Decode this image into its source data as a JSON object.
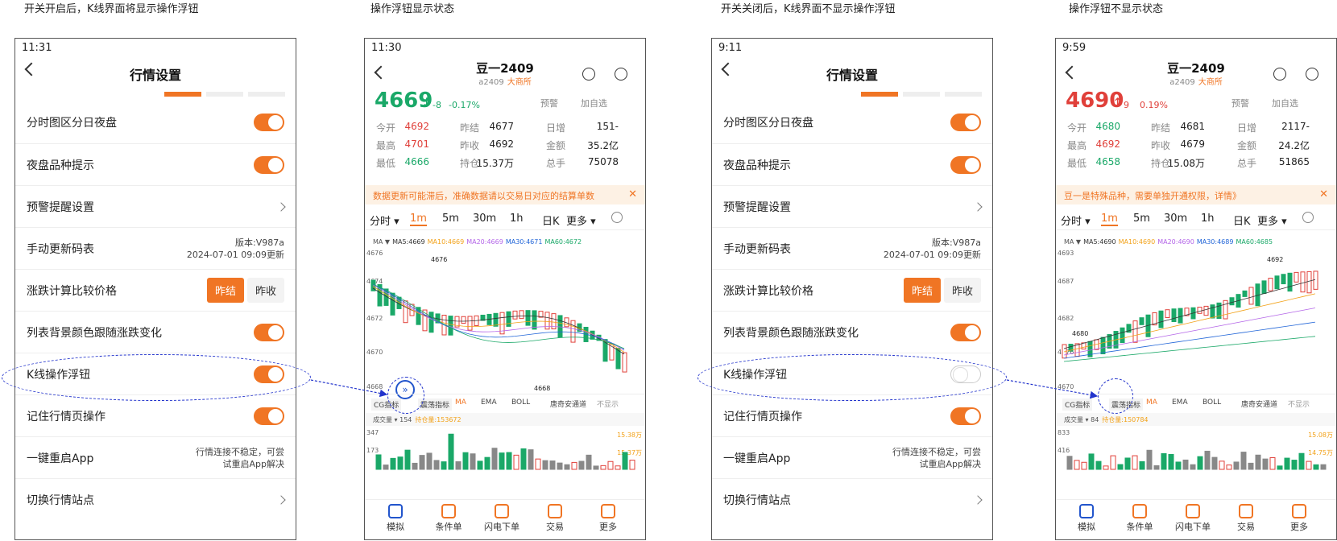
{
  "captions": [
    "开关开启后，K线界面将显示操作浮钮",
    "操作浮钮显示状态",
    "开关关闭后，K线界面不显示操作浮钮",
    "操作浮钮不显示状态"
  ],
  "settings_screens": [
    {
      "time": "11:31",
      "float_on": true
    },
    {
      "time": "9:11",
      "float_on": false
    }
  ],
  "settings": {
    "title": "行情设置",
    "rows": [
      {
        "label": "分时图区分日夜盘",
        "type": "toggle"
      },
      {
        "label": "夜盘品种提示",
        "type": "toggle"
      },
      {
        "label": "预警提醒设置",
        "type": "chevron"
      },
      {
        "label": "手动更新码表",
        "type": "text",
        "right_line1": "版本:V987a",
        "right_line2": "2024-07-01 09:09更新"
      },
      {
        "label": "涨跌计算比较价格",
        "type": "buttons",
        "btn1": "昨结",
        "btn2": "昨收"
      },
      {
        "label": "列表背景颜色跟随涨跌变化",
        "type": "toggle"
      },
      {
        "label": "K线操作浮钮",
        "type": "toggle-float"
      },
      {
        "label": "记住行情页操作",
        "type": "toggle"
      },
      {
        "label": "一键重启App",
        "type": "text",
        "right_line1": "行情连接不稳定，可尝",
        "right_line2": "试重启App解决"
      },
      {
        "label": "切换行情站点",
        "type": "chevron"
      }
    ]
  },
  "kline_screens": [
    {
      "time": "11:30",
      "title": "豆一2409",
      "sub": "a2409",
      "exchange": "大商所",
      "price": "4669",
      "arrow": "↓",
      "chg": "-8",
      "pct": "-0.17%",
      "color": "#1aa868",
      "alarm": "预警",
      "watch": "加自选",
      "quotes": [
        [
          "今开",
          "4692",
          "昨结",
          "4677",
          "日增",
          "-151"
        ],
        [
          "最高",
          "4701",
          "昨收",
          "4692",
          "金额",
          "35.2亿"
        ],
        [
          "最低",
          "4666",
          "持仓",
          "15.37万",
          "总手",
          "75078"
        ]
      ],
      "q_colors": [
        "#e0403a",
        "#e0403a",
        "#1aa868"
      ],
      "notice": "数据更新可能滞后，准确数据请以交易日对应的结算单数",
      "ma": [
        "MA ▼",
        "MA5:4669",
        "MA10:4669",
        "MA20:4669",
        "MA30:4671",
        "MA60:4672"
      ],
      "y_labels": [
        "4676",
        "4674",
        "4672",
        "4670",
        "4668"
      ],
      "hi_label": "4676",
      "lo_label": "4668",
      "vol": "成交量 ▾  154",
      "oi": "持仓量:153672",
      "v_left": [
        "347",
        "173"
      ],
      "v_right": [
        "15.38万",
        "15.37万"
      ]
    },
    {
      "time": "9:59",
      "title": "豆一2409",
      "sub": "a2409",
      "exchange": "大商所",
      "price": "4690",
      "arrow": "↑",
      "chg": "9",
      "pct": "0.19%",
      "color": "#e0403a",
      "alarm": "预警",
      "watch": "加自选",
      "quotes": [
        [
          "今开",
          "4680",
          "昨结",
          "4681",
          "日增",
          "-2117"
        ],
        [
          "最高",
          "4692",
          "昨收",
          "4679",
          "金额",
          "24.2亿"
        ],
        [
          "最低",
          "4658",
          "持仓",
          "15.08万",
          "总手",
          "51865"
        ]
      ],
      "q_colors": [
        "#1aa868",
        "#e0403a",
        "#1aa868"
      ],
      "notice": "豆一是特殊品种，需要单独开通权限，详情》",
      "ma": [
        "MA ▼",
        "MA5:4690",
        "MA10:4690",
        "MA20:4690",
        "MA30:4689",
        "MA60:4685"
      ],
      "y_labels": [
        "4693",
        "4687",
        "4682",
        "4676",
        "4670"
      ],
      "hi_label": "4692",
      "lo_label": "4680",
      "vol": "成交量 ▾  84",
      "oi": "持仓量:150784",
      "v_left": [
        "833",
        "416"
      ],
      "v_right": [
        "15.08万",
        "14.75万"
      ]
    }
  ],
  "period_tabs": [
    "分时 ▾",
    "1m",
    "5m",
    "30m",
    "1h",
    "日K",
    "更多 ▾"
  ],
  "indicators": [
    "CG指标",
    "震荡指标",
    "MA",
    "EMA",
    "BOLL",
    "唐奇安通道",
    "不显示"
  ],
  "tabbar": [
    "模拟",
    "条件单",
    "闪电下单",
    "交易",
    "更多"
  ]
}
